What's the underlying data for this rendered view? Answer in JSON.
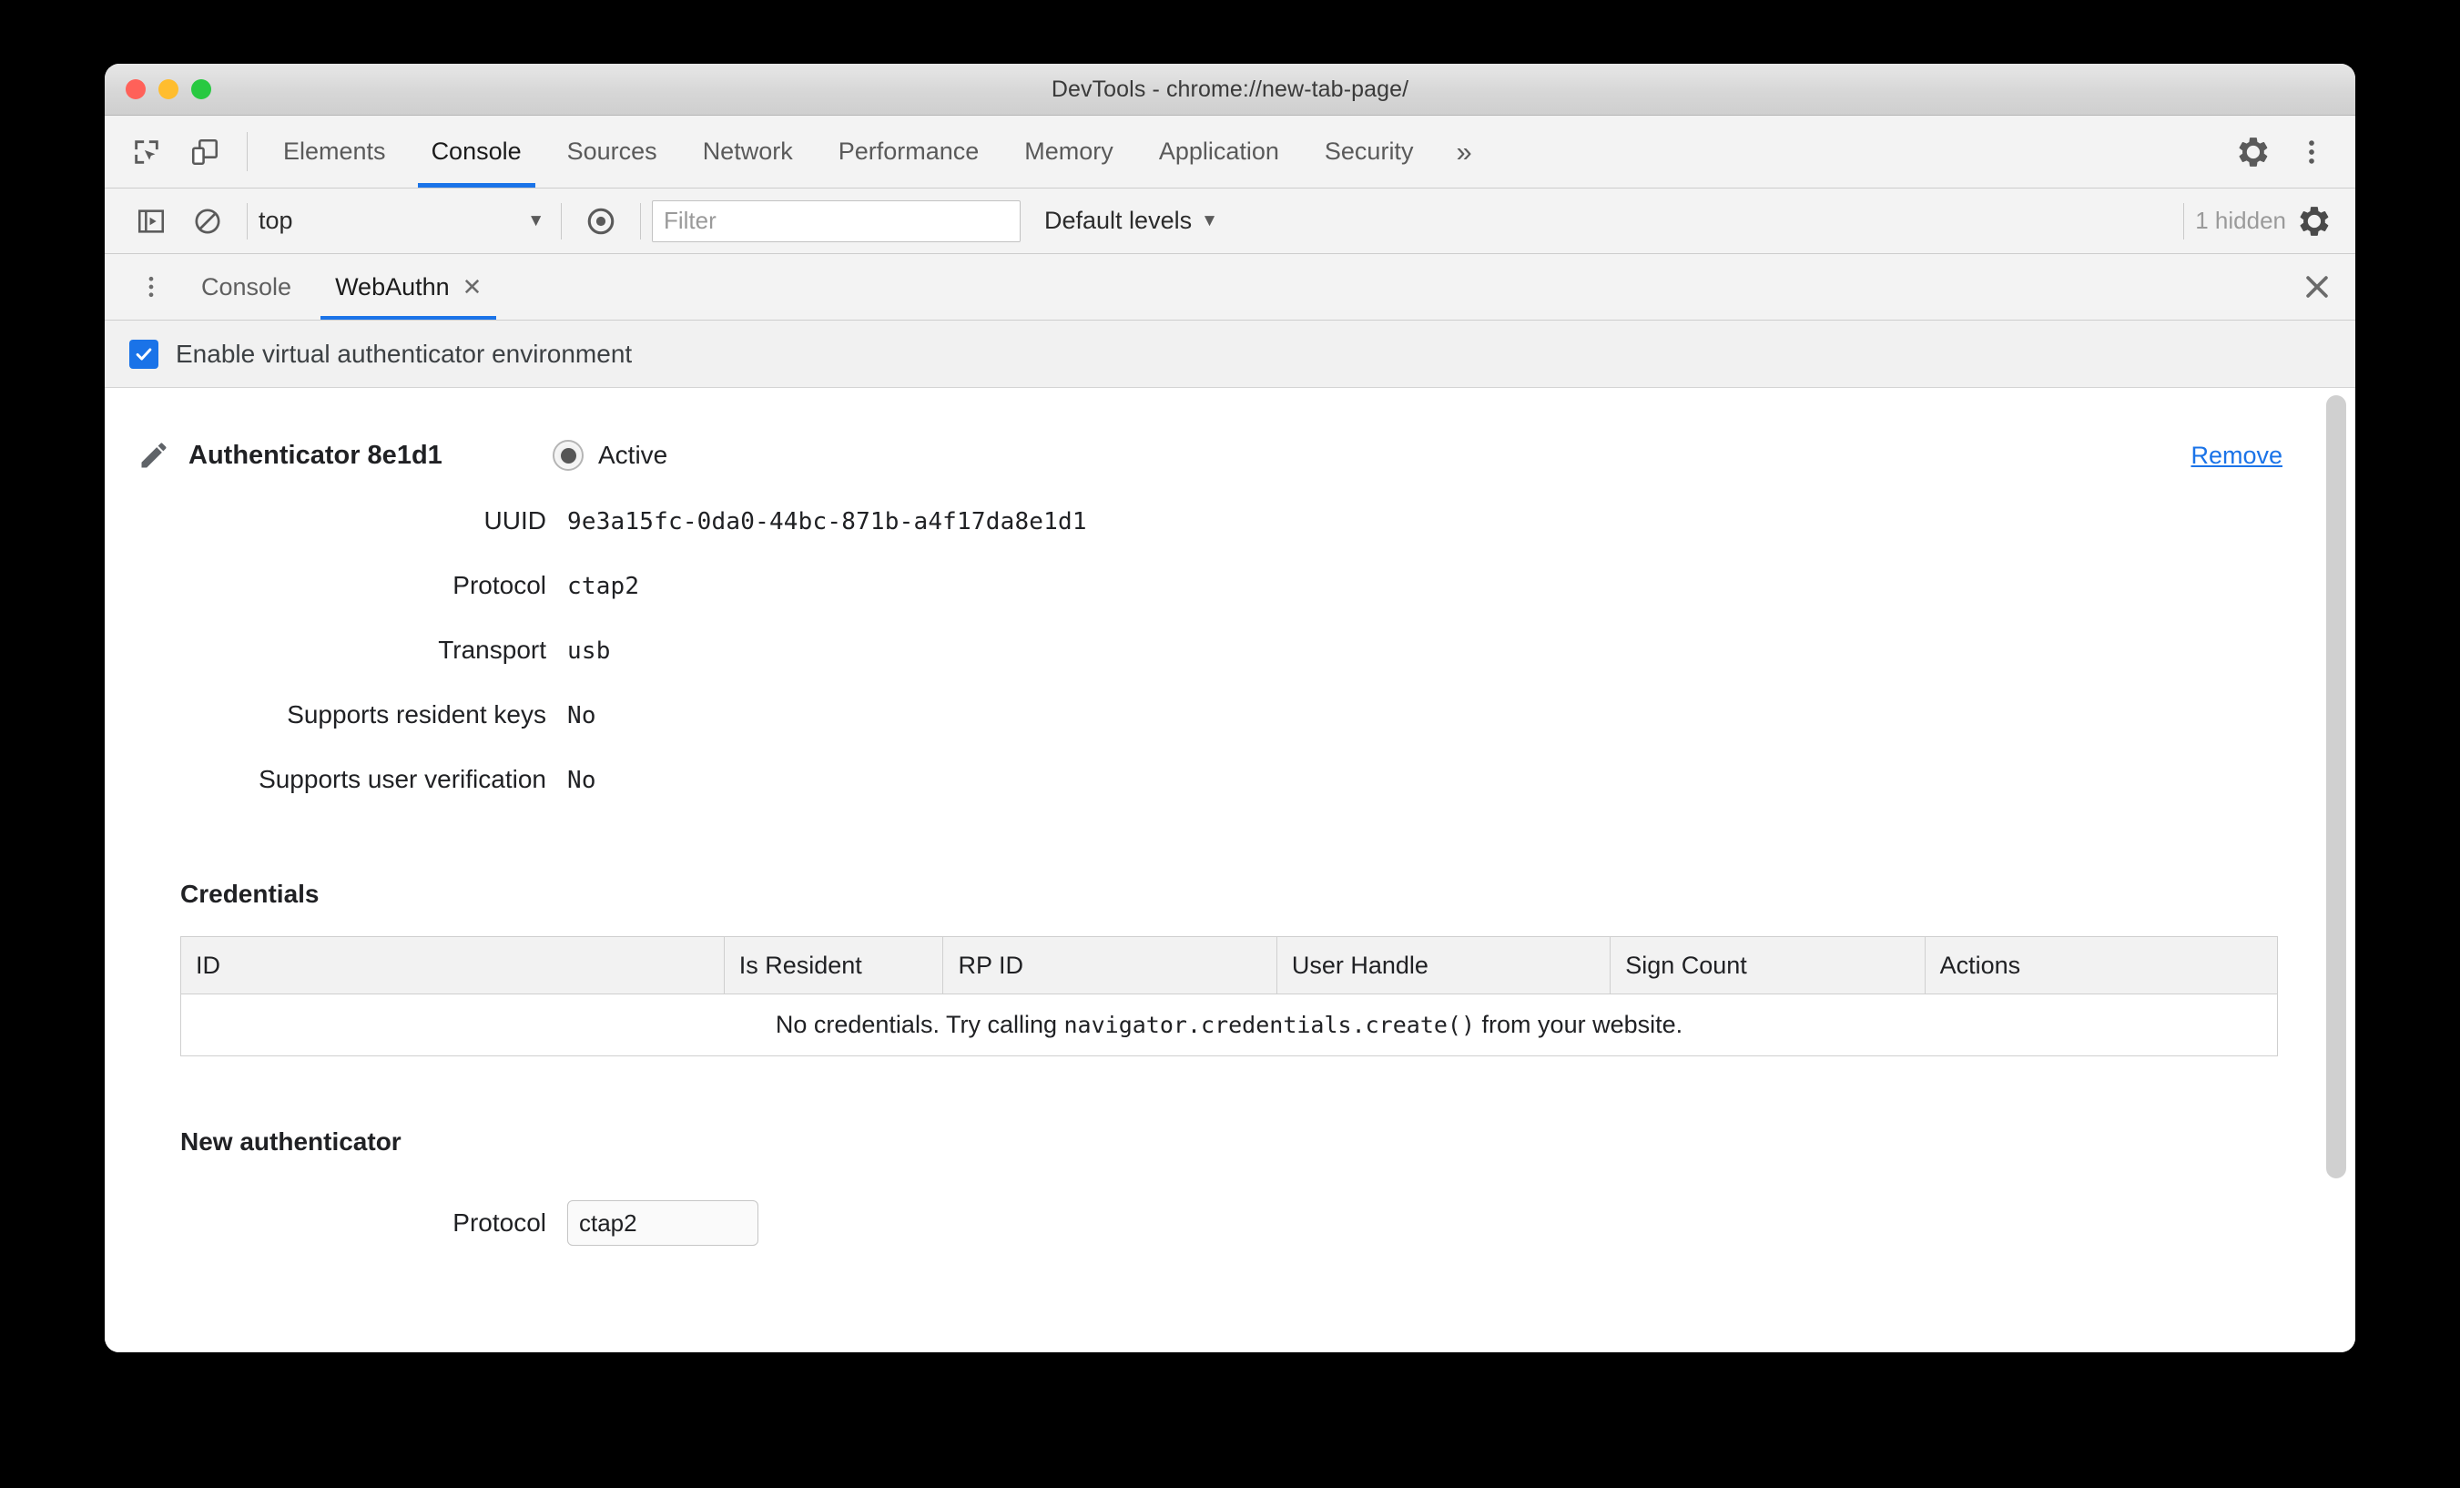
{
  "window": {
    "title": "DevTools - chrome://new-tab-page/",
    "traffic_lights": [
      "close",
      "minimize",
      "zoom"
    ]
  },
  "devtools_toolbar": {
    "inspect_icon": "inspect-element-icon",
    "device_toolbar_icon": "device-toolbar-icon",
    "tabs": [
      {
        "label": "Elements",
        "active": false
      },
      {
        "label": "Console",
        "active": true
      },
      {
        "label": "Sources",
        "active": false
      },
      {
        "label": "Network",
        "active": false
      },
      {
        "label": "Performance",
        "active": false
      },
      {
        "label": "Memory",
        "active": false
      },
      {
        "label": "Application",
        "active": false
      },
      {
        "label": "Security",
        "active": false
      }
    ],
    "more_tabs_label": "»",
    "settings_icon": "gear-icon",
    "more_options_icon": "kebab-menu-icon"
  },
  "console_toolbar": {
    "sidebar_toggle_icon": "console-sidebar-icon",
    "clear_console_icon": "clear-console-icon",
    "context": {
      "value": "top",
      "caret": "▼"
    },
    "live_expression_icon": "eye-icon",
    "filter": {
      "value": "",
      "placeholder": "Filter"
    },
    "levels": {
      "label": "Default levels",
      "caret": "▼"
    },
    "hidden_count": "1 hidden",
    "settings_icon": "gear-icon"
  },
  "drawer": {
    "more_tools_icon": "kebab-menu-icon",
    "tabs": [
      {
        "label": "Console",
        "active": false,
        "closeable": false
      },
      {
        "label": "WebAuthn",
        "active": true,
        "closeable": true,
        "close_glyph": "✕"
      }
    ],
    "close_drawer_icon": "close-icon",
    "close_drawer_glyph": "✕"
  },
  "webauthn": {
    "enable_checkbox": {
      "label": "Enable virtual authenticator environment",
      "checked": true
    },
    "authenticator": {
      "edit_icon": "pencil-icon",
      "title": "Authenticator 8e1d1",
      "active_radio": {
        "label": "Active",
        "selected": true
      },
      "remove_label": "Remove",
      "properties": [
        {
          "key": "UUID",
          "value": "9e3a15fc-0da0-44bc-871b-a4f17da8e1d1"
        },
        {
          "key": "Protocol",
          "value": "ctap2"
        },
        {
          "key": "Transport",
          "value": "usb"
        },
        {
          "key": "Supports resident keys",
          "value": "No"
        },
        {
          "key": "Supports user verification",
          "value": "No"
        }
      ]
    },
    "credentials": {
      "heading": "Credentials",
      "columns": [
        "ID",
        "Is Resident",
        "RP ID",
        "User Handle",
        "Sign Count",
        "Actions"
      ],
      "rows": [],
      "empty_prefix": "No credentials. Try calling ",
      "empty_code": "navigator.credentials.create()",
      "empty_suffix": " from your website."
    },
    "new_authenticator": {
      "heading": "New authenticator",
      "protocol_label": "Protocol",
      "protocol_value": "ctap2"
    }
  },
  "colors": {
    "accent": "#1a73e8",
    "toolbar_bg": "#f3f3f3",
    "text": "#202124",
    "muted": "#9a9a9a",
    "border": "#cfcfcf"
  }
}
